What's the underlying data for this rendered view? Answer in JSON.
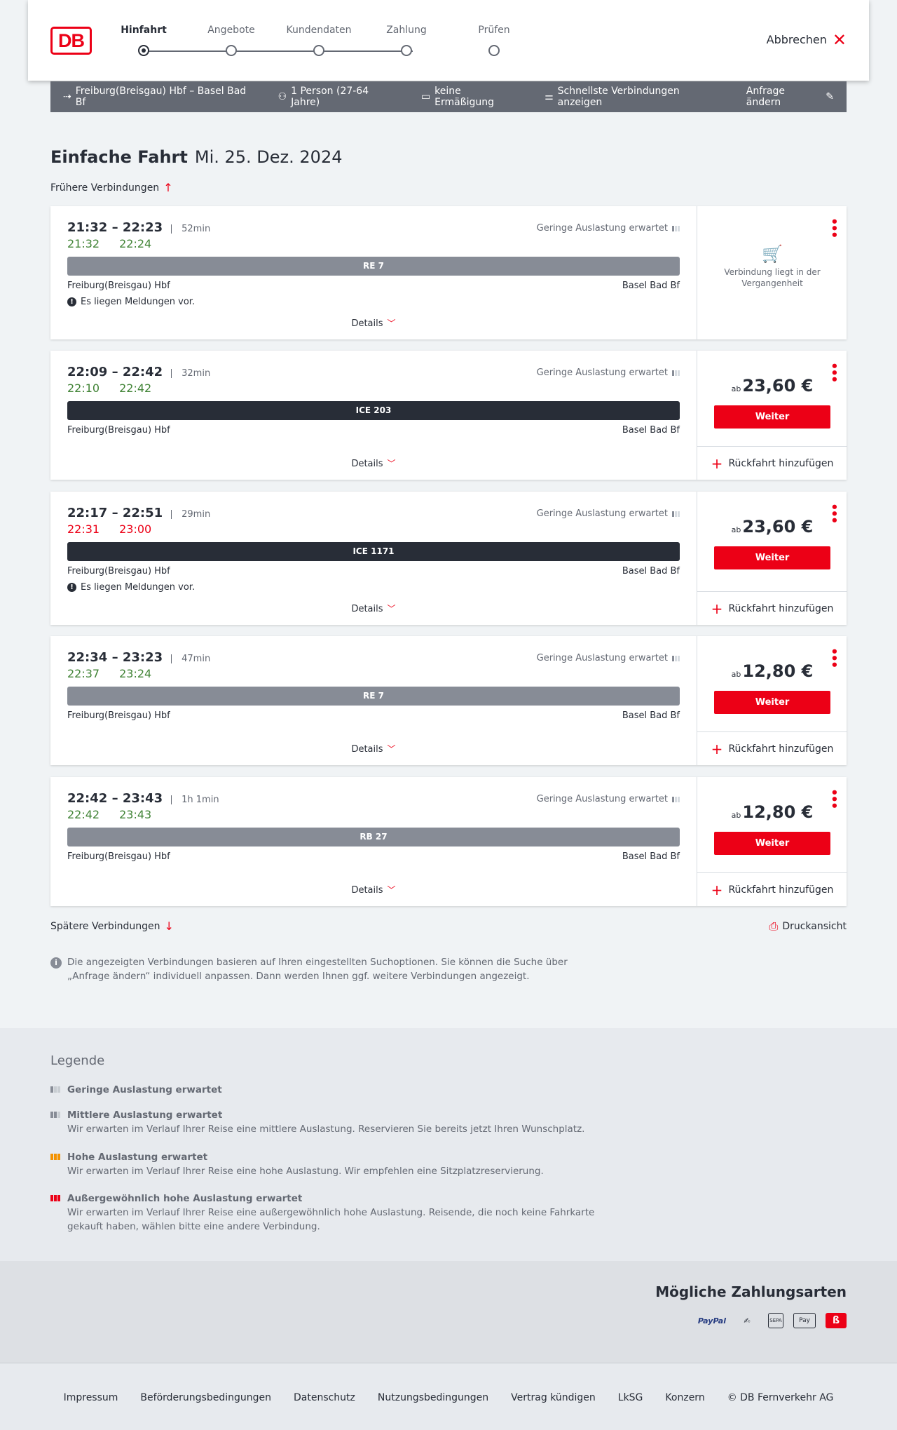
{
  "header": {
    "steps": [
      {
        "label": "Hinfahrt",
        "active": true
      },
      {
        "label": "Angebote"
      },
      {
        "label": "Kundendaten"
      },
      {
        "label": "Zahlung"
      },
      {
        "label": "Prüfen"
      }
    ],
    "cancel": "Abbrechen",
    "logo": "DB"
  },
  "search": {
    "route": "Freiburg(Breisgau) Hbf – Basel Bad Bf",
    "persons": "1 Person (27-64 Jahre)",
    "discount": "keine Ermäßigung",
    "fastest": "Schnellste Verbindungen anzeigen",
    "change": "Anfrage ändern"
  },
  "title": {
    "type": "Einfache Fahrt",
    "date": "Mi. 25. Dez. 2024"
  },
  "earlier": "Frühere Verbindungen",
  "later": "Spätere Verbindungen",
  "print": "Druckansicht",
  "connections": [
    {
      "times": "21:32 – 22:23",
      "duration": "52min",
      "rt_dep": "21:32",
      "rt_arr": "22:24",
      "rt_color": "green",
      "occupancy": "Geringe Auslastung erwartet",
      "train": "RE 7",
      "train_type": "re",
      "from": "Freiburg(Breisgau) Hbf",
      "to": "Basel Bad Bf",
      "message": "Es liegen Meldungen vor.",
      "details": "Details",
      "past": "Verbindung liegt in der Vergangenheit"
    },
    {
      "times": "22:09 – 22:42",
      "duration": "32min",
      "rt_dep": "22:10",
      "rt_arr": "22:42",
      "rt_color": "green",
      "occupancy": "Geringe Auslastung erwartet",
      "train": "ICE 203",
      "train_type": "ice",
      "from": "Freiburg(Breisgau) Hbf",
      "to": "Basel Bad Bf",
      "details": "Details",
      "price_prefix": "ab",
      "price": "23,60 €",
      "button": "Weiter",
      "return": "Rückfahrt hinzufügen"
    },
    {
      "times": "22:17 – 22:51",
      "duration": "29min",
      "rt_dep": "22:31",
      "rt_arr": "23:00",
      "rt_color": "red",
      "occupancy": "Geringe Auslastung erwartet",
      "train": "ICE 1171",
      "train_type": "ice",
      "from": "Freiburg(Breisgau) Hbf",
      "to": "Basel Bad Bf",
      "message": "Es liegen Meldungen vor.",
      "details": "Details",
      "price_prefix": "ab",
      "price": "23,60 €",
      "button": "Weiter",
      "return": "Rückfahrt hinzufügen"
    },
    {
      "times": "22:34 – 23:23",
      "duration": "47min",
      "rt_dep": "22:37",
      "rt_arr": "23:24",
      "rt_color": "green",
      "occupancy": "Geringe Auslastung erwartet",
      "train": "RE 7",
      "train_type": "re",
      "from": "Freiburg(Breisgau) Hbf",
      "to": "Basel Bad Bf",
      "details": "Details",
      "price_prefix": "ab",
      "price": "12,80 €",
      "button": "Weiter",
      "return": "Rückfahrt hinzufügen"
    },
    {
      "times": "22:42 – 23:43",
      "duration": "1h 1min",
      "rt_dep": "22:42",
      "rt_arr": "23:43",
      "rt_color": "green",
      "occupancy": "Geringe Auslastung erwartet",
      "train": "RB 27",
      "train_type": "re",
      "from": "Freiburg(Breisgau) Hbf",
      "to": "Basel Bad Bf",
      "details": "Details",
      "price_prefix": "ab",
      "price": "12,80 €",
      "button": "Weiter",
      "return": "Rückfahrt hinzufügen"
    }
  ],
  "info": "Die angezeigten Verbindungen basieren auf Ihren eingestellten Suchoptionen. Sie können die Suche über „Anfrage ändern“ individuell anpassen. Dann werden Ihnen ggf. weitere Verbindungen angezeigt.",
  "legend": {
    "title": "Legende",
    "items": [
      {
        "title": "Geringe Auslastung erwartet",
        "text": "",
        "color": "#878c96"
      },
      {
        "title": "Mittlere Auslastung erwartet",
        "text": "Wir erwarten im Verlauf Ihrer Reise eine mittlere Auslastung. Reservieren Sie bereits jetzt Ihren Wunschplatz.",
        "color": "#878c96"
      },
      {
        "title": "Hohe Auslastung erwartet",
        "text": "Wir erwarten im Verlauf Ihrer Reise eine hohe Auslastung. Wir empfehlen eine Sitzplatzreservierung.",
        "color": "#f39200"
      },
      {
        "title": "Außergewöhnlich hohe Auslastung erwartet",
        "text": "Wir erwarten im Verlauf Ihrer Reise eine außergewöhnlich hohe Auslastung. Reisende, die noch keine Fahrkarte gekauft haben, wählen bitte eine andere Verbindung.",
        "color": "#ec0016"
      }
    ]
  },
  "payment": {
    "title": "Mögliche Zahlungsarten",
    "methods": [
      "PayPal",
      "Lastschrift",
      "SEPA",
      "Apple Pay",
      "Bonus"
    ]
  },
  "footer": {
    "links": [
      "Impressum",
      "Beförderungsbedingungen",
      "Datenschutz",
      "Nutzungsbedingungen",
      "Vertrag kündigen",
      "LkSG",
      "Konzern",
      "© DB Fernverkehr AG"
    ]
  }
}
